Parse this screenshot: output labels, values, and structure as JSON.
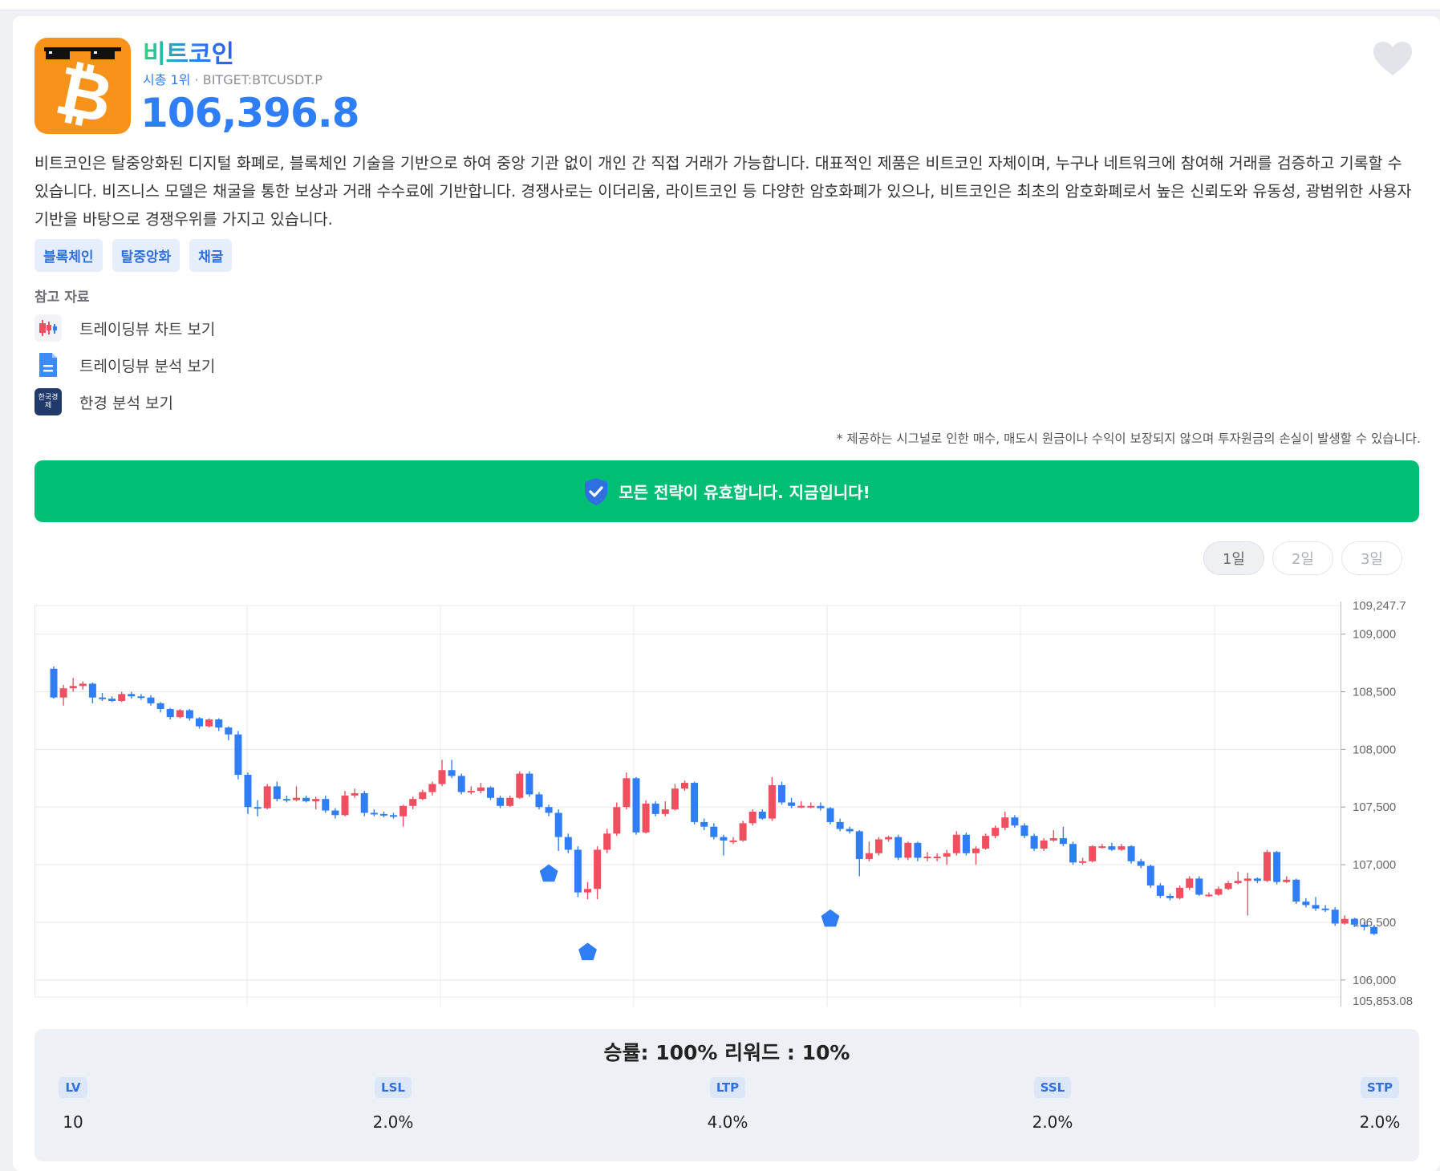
{
  "coin": {
    "name": "비트코인",
    "rank": "시총 1위",
    "separator": "·",
    "ticker": "BITGET:BTCUSDT.P",
    "price": "106,396.8",
    "logo_symbol": "₿",
    "logo_icon": "bitcoin-sunglasses-icon",
    "favorite_icon": "heart-icon",
    "description": "비트코인은 탈중앙화된 디지털 화폐로, 블록체인 기술을 기반으로 하여 중앙 기관 없이 개인 간 직접 거래가 가능합니다. 대표적인 제품은 비트코인 자체이며, 누구나 네트워크에 참여해 거래를 검증하고 기록할 수 있습니다. 비즈니스 모델은 채굴을 통한 보상과 거래 수수료에 기반합니다. 경쟁사로는 이더리움, 라이트코인 등 다양한 암호화폐가 있으나, 비트코인은 최초의 암호화폐로서 높은 신뢰도와 유동성, 광범위한 사용자 기반을 바탕으로 경쟁우위를 가지고 있습니다.",
    "tags": [
      "블록체인",
      "탈중앙화",
      "채굴"
    ]
  },
  "references": {
    "title": "참고 자료",
    "items": [
      {
        "label": "트레이딩뷰 차트 보기",
        "icon": "candlestick-icon"
      },
      {
        "label": "트레이딩뷰 분석 보기",
        "icon": "document-icon"
      },
      {
        "label": "한경 분석 보기",
        "icon": "hankyung-logo-icon",
        "icon_text": "한국경제"
      }
    ]
  },
  "disclaimer": "* 제공하는 시그널로 인한 매수, 매도시 원금이나 수익이 보장되지 않으며 투자원금의 손실이 발생할 수 있습니다.",
  "banner": {
    "text": "모든 전략이 유효합니다. 지금입니다!",
    "icon": "shield-check-icon",
    "color": "#00bf75"
  },
  "periods": [
    {
      "label": "1일",
      "active": true
    },
    {
      "label": "2일",
      "active": false
    },
    {
      "label": "3일",
      "active": false
    }
  ],
  "chart_data": {
    "type": "candlestick",
    "y_range": [
      105853.08,
      109247.7
    ],
    "y_ticks": [
      "109,000",
      "108,500",
      "108,000",
      "107,500",
      "107,000",
      "106,500",
      "106,000"
    ],
    "y_min_label": "105,853.08",
    "y_max_label": "109,247.7",
    "up_color": "#ef4f5f",
    "down_color": "#2f7ef7",
    "candles": [
      [
        108700,
        108450,
        108720,
        108440
      ],
      [
        108450,
        108530,
        108560,
        108380
      ],
      [
        108530,
        108550,
        108620,
        108500
      ],
      [
        108550,
        108570,
        108590,
        108520
      ],
      [
        108570,
        108450,
        108580,
        108400
      ],
      [
        108450,
        108440,
        108490,
        108420
      ],
      [
        108440,
        108420,
        108460,
        108410
      ],
      [
        108420,
        108480,
        108500,
        108410
      ],
      [
        108480,
        108460,
        108500,
        108440
      ],
      [
        108460,
        108450,
        108480,
        108430
      ],
      [
        108450,
        108400,
        108470,
        108380
      ],
      [
        108400,
        108350,
        108410,
        108320
      ],
      [
        108350,
        108280,
        108360,
        108260
      ],
      [
        108280,
        108340,
        108350,
        108270
      ],
      [
        108340,
        108270,
        108350,
        108250
      ],
      [
        108270,
        108200,
        108280,
        108180
      ],
      [
        108200,
        108260,
        108270,
        108190
      ],
      [
        108260,
        108190,
        108270,
        108160
      ],
      [
        108190,
        108130,
        108200,
        108080
      ],
      [
        108130,
        107780,
        108160,
        107740
      ],
      [
        107780,
        107500,
        107800,
        107440
      ],
      [
        107500,
        107490,
        107560,
        107420
      ],
      [
        107490,
        107680,
        107700,
        107480
      ],
      [
        107680,
        107570,
        107720,
        107550
      ],
      [
        107570,
        107560,
        107600,
        107540
      ],
      [
        107560,
        107580,
        107680,
        107550
      ],
      [
        107580,
        107550,
        107600,
        107540
      ],
      [
        107550,
        107570,
        107590,
        107480
      ],
      [
        107570,
        107470,
        107600,
        107450
      ],
      [
        107470,
        107430,
        107490,
        107400
      ],
      [
        107430,
        107600,
        107640,
        107420
      ],
      [
        107600,
        107620,
        107660,
        107580
      ],
      [
        107620,
        107450,
        107640,
        107420
      ],
      [
        107450,
        107440,
        107480,
        107420
      ],
      [
        107440,
        107430,
        107460,
        107410
      ],
      [
        107430,
        107420,
        107450,
        107400
      ],
      [
        107420,
        107510,
        107520,
        107330
      ],
      [
        107510,
        107570,
        107590,
        107480
      ],
      [
        107570,
        107630,
        107650,
        107560
      ],
      [
        107630,
        107700,
        107720,
        107600
      ],
      [
        107700,
        107820,
        107910,
        107680
      ],
      [
        107820,
        107770,
        107910,
        107750
      ],
      [
        107770,
        107630,
        107790,
        107610
      ],
      [
        107630,
        107640,
        107680,
        107610
      ],
      [
        107640,
        107670,
        107710,
        107620
      ],
      [
        107670,
        107580,
        107680,
        107560
      ],
      [
        107580,
        107510,
        107600,
        107490
      ],
      [
        107510,
        107580,
        107600,
        107500
      ],
      [
        107580,
        107790,
        107810,
        107570
      ],
      [
        107790,
        107610,
        107810,
        107590
      ],
      [
        107610,
        107500,
        107630,
        107480
      ],
      [
        107500,
        107450,
        107520,
        107420
      ],
      [
        107450,
        107240,
        107480,
        107120
      ],
      [
        107240,
        107130,
        107270,
        107100
      ],
      [
        107130,
        106760,
        107160,
        106720
      ],
      [
        106760,
        106790,
        106850,
        106700
      ],
      [
        106790,
        107130,
        107160,
        106700
      ],
      [
        107130,
        107270,
        107310,
        107100
      ],
      [
        107270,
        107500,
        107540,
        107250
      ],
      [
        107500,
        107750,
        107800,
        107480
      ],
      [
        107750,
        107280,
        107760,
        107260
      ],
      [
        107280,
        107530,
        107560,
        107270
      ],
      [
        107530,
        107440,
        107550,
        107420
      ],
      [
        107440,
        107480,
        107550,
        107420
      ],
      [
        107480,
        107660,
        107700,
        107470
      ],
      [
        107660,
        107710,
        107730,
        107640
      ],
      [
        107710,
        107370,
        107720,
        107350
      ],
      [
        107370,
        107330,
        107400,
        107300
      ],
      [
        107330,
        107240,
        107360,
        107220
      ],
      [
        107240,
        107210,
        107260,
        107080
      ],
      [
        107210,
        107210,
        107240,
        107180
      ],
      [
        107210,
        107360,
        107380,
        107200
      ],
      [
        107360,
        107460,
        107480,
        107340
      ],
      [
        107460,
        107400,
        107480,
        107390
      ],
      [
        107400,
        107690,
        107760,
        107380
      ],
      [
        107690,
        107540,
        107720,
        107520
      ],
      [
        107540,
        107510,
        107580,
        107490
      ],
      [
        107510,
        107510,
        107550,
        107490
      ],
      [
        107510,
        107510,
        107540,
        107490
      ],
      [
        107510,
        107490,
        107540,
        107470
      ],
      [
        107490,
        107370,
        107500,
        107350
      ],
      [
        107370,
        107310,
        107400,
        107290
      ],
      [
        107310,
        107290,
        107330,
        107270
      ],
      [
        107290,
        107050,
        107300,
        106900
      ],
      [
        107050,
        107100,
        107200,
        107030
      ],
      [
        107100,
        107220,
        107240,
        107080
      ],
      [
        107220,
        107240,
        107250,
        107200
      ],
      [
        107240,
        107060,
        107260,
        107040
      ],
      [
        107060,
        107190,
        107200,
        107040
      ],
      [
        107190,
        107060,
        107200,
        107030
      ],
      [
        107060,
        107070,
        107110,
        107030
      ],
      [
        107070,
        107070,
        107100,
        107030
      ],
      [
        107070,
        107100,
        107130,
        107000
      ],
      [
        107100,
        107260,
        107290,
        107080
      ],
      [
        107260,
        107100,
        107280,
        107080
      ],
      [
        107100,
        107140,
        107160,
        107000
      ],
      [
        107140,
        107250,
        107270,
        107130
      ],
      [
        107250,
        107320,
        107340,
        107230
      ],
      [
        107320,
        107410,
        107460,
        107300
      ],
      [
        107410,
        107340,
        107430,
        107320
      ],
      [
        107340,
        107250,
        107360,
        107230
      ],
      [
        107250,
        107140,
        107270,
        107120
      ],
      [
        107140,
        107210,
        107230,
        107120
      ],
      [
        107210,
        107230,
        107300,
        107200
      ],
      [
        107230,
        107180,
        107330,
        107160
      ],
      [
        107180,
        107020,
        107200,
        107000
      ],
      [
        107020,
        107030,
        107060,
        107000
      ],
      [
        107030,
        107160,
        107170,
        107020
      ],
      [
        107160,
        107160,
        107180,
        107140
      ],
      [
        107160,
        107130,
        107190,
        107120
      ],
      [
        107130,
        107160,
        107180,
        107120
      ],
      [
        107160,
        107030,
        107170,
        107010
      ],
      [
        107030,
        106990,
        107050,
        106970
      ],
      [
        106990,
        106820,
        107000,
        106800
      ],
      [
        106820,
        106730,
        106840,
        106710
      ],
      [
        106730,
        106710,
        106750,
        106690
      ],
      [
        106710,
        106800,
        106820,
        106700
      ],
      [
        106800,
        106880,
        106900,
        106780
      ],
      [
        106880,
        106740,
        106900,
        106730
      ],
      [
        106740,
        106740,
        106760,
        106720
      ],
      [
        106740,
        106790,
        106810,
        106730
      ],
      [
        106790,
        106840,
        106860,
        106780
      ],
      [
        106840,
        106860,
        106940,
        106830
      ],
      [
        106860,
        106880,
        106930,
        106560
      ],
      [
        106880,
        106860,
        106890,
        106840
      ],
      [
        106860,
        107110,
        107130,
        106850
      ],
      [
        107110,
        106850,
        107120,
        106830
      ],
      [
        106850,
        106870,
        106900,
        106840
      ],
      [
        106870,
        106680,
        106880,
        106660
      ],
      [
        106680,
        106650,
        106710,
        106630
      ],
      [
        106650,
        106620,
        106720,
        106600
      ],
      [
        106620,
        106610,
        106650,
        106590
      ],
      [
        106610,
        106490,
        106630,
        106470
      ],
      [
        106490,
        106530,
        106560,
        106480
      ],
      [
        106530,
        106480,
        106540,
        106460
      ],
      [
        106480,
        106460,
        106500,
        106430
      ],
      [
        106460,
        106400,
        106470,
        106390
      ]
    ],
    "signal_markers": [
      {
        "candle": 51,
        "price": 106920
      },
      {
        "candle": 55,
        "price": 106240
      },
      {
        "candle": 80,
        "price": 106530
      }
    ]
  },
  "stats": {
    "headline": "승률: 100% 리워드 : 10%",
    "items": [
      {
        "label": "LV",
        "value": "10"
      },
      {
        "label": "LSL",
        "value": "2.0%"
      },
      {
        "label": "LTP",
        "value": "4.0%"
      },
      {
        "label": "SSL",
        "value": "2.0%"
      },
      {
        "label": "STP",
        "value": "2.0%"
      }
    ]
  }
}
